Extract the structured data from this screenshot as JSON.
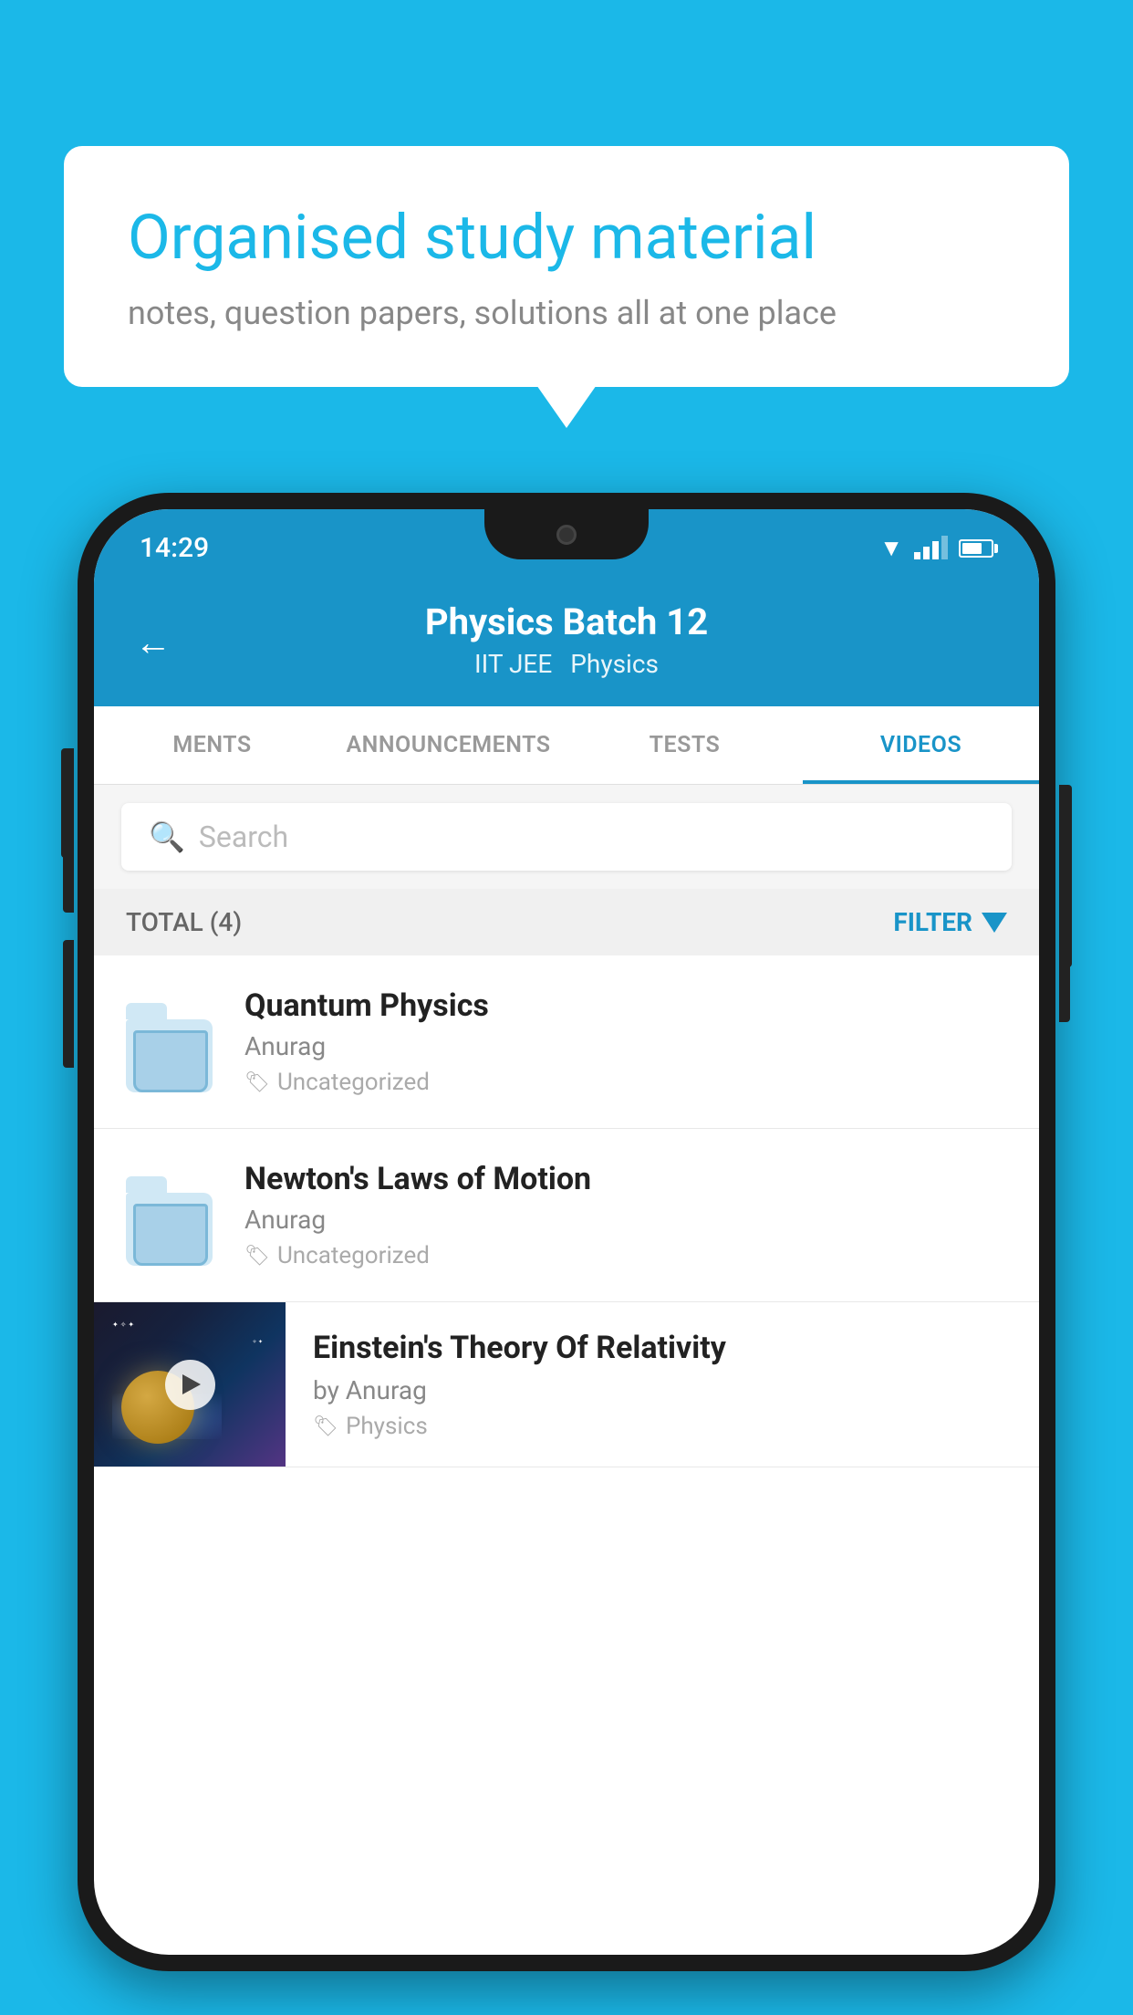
{
  "background_color": "#1bb8e8",
  "speech_bubble": {
    "title": "Organised study material",
    "subtitle": "notes, question papers, solutions all at one place"
  },
  "phone": {
    "status_bar": {
      "time": "14:29",
      "signal": "full",
      "battery": "70"
    },
    "header": {
      "back_label": "←",
      "title": "Physics Batch 12",
      "tag1": "IIT JEE",
      "tag2": "Physics"
    },
    "tabs": [
      {
        "label": "MENTS",
        "active": false
      },
      {
        "label": "ANNOUNCEMENTS",
        "active": false
      },
      {
        "label": "TESTS",
        "active": false
      },
      {
        "label": "VIDEOS",
        "active": true
      }
    ],
    "search": {
      "placeholder": "Search"
    },
    "filter_bar": {
      "total_label": "TOTAL (4)",
      "filter_label": "FILTER"
    },
    "videos": [
      {
        "id": 1,
        "title": "Quantum Physics",
        "author": "Anurag",
        "tag": "Uncategorized",
        "type": "folder"
      },
      {
        "id": 2,
        "title": "Newton's Laws of Motion",
        "author": "Anurag",
        "tag": "Uncategorized",
        "type": "folder"
      },
      {
        "id": 3,
        "title": "Einstein's Theory Of Relativity",
        "author_prefix": "by",
        "author": "Anurag",
        "tag": "Physics",
        "type": "video"
      }
    ]
  }
}
